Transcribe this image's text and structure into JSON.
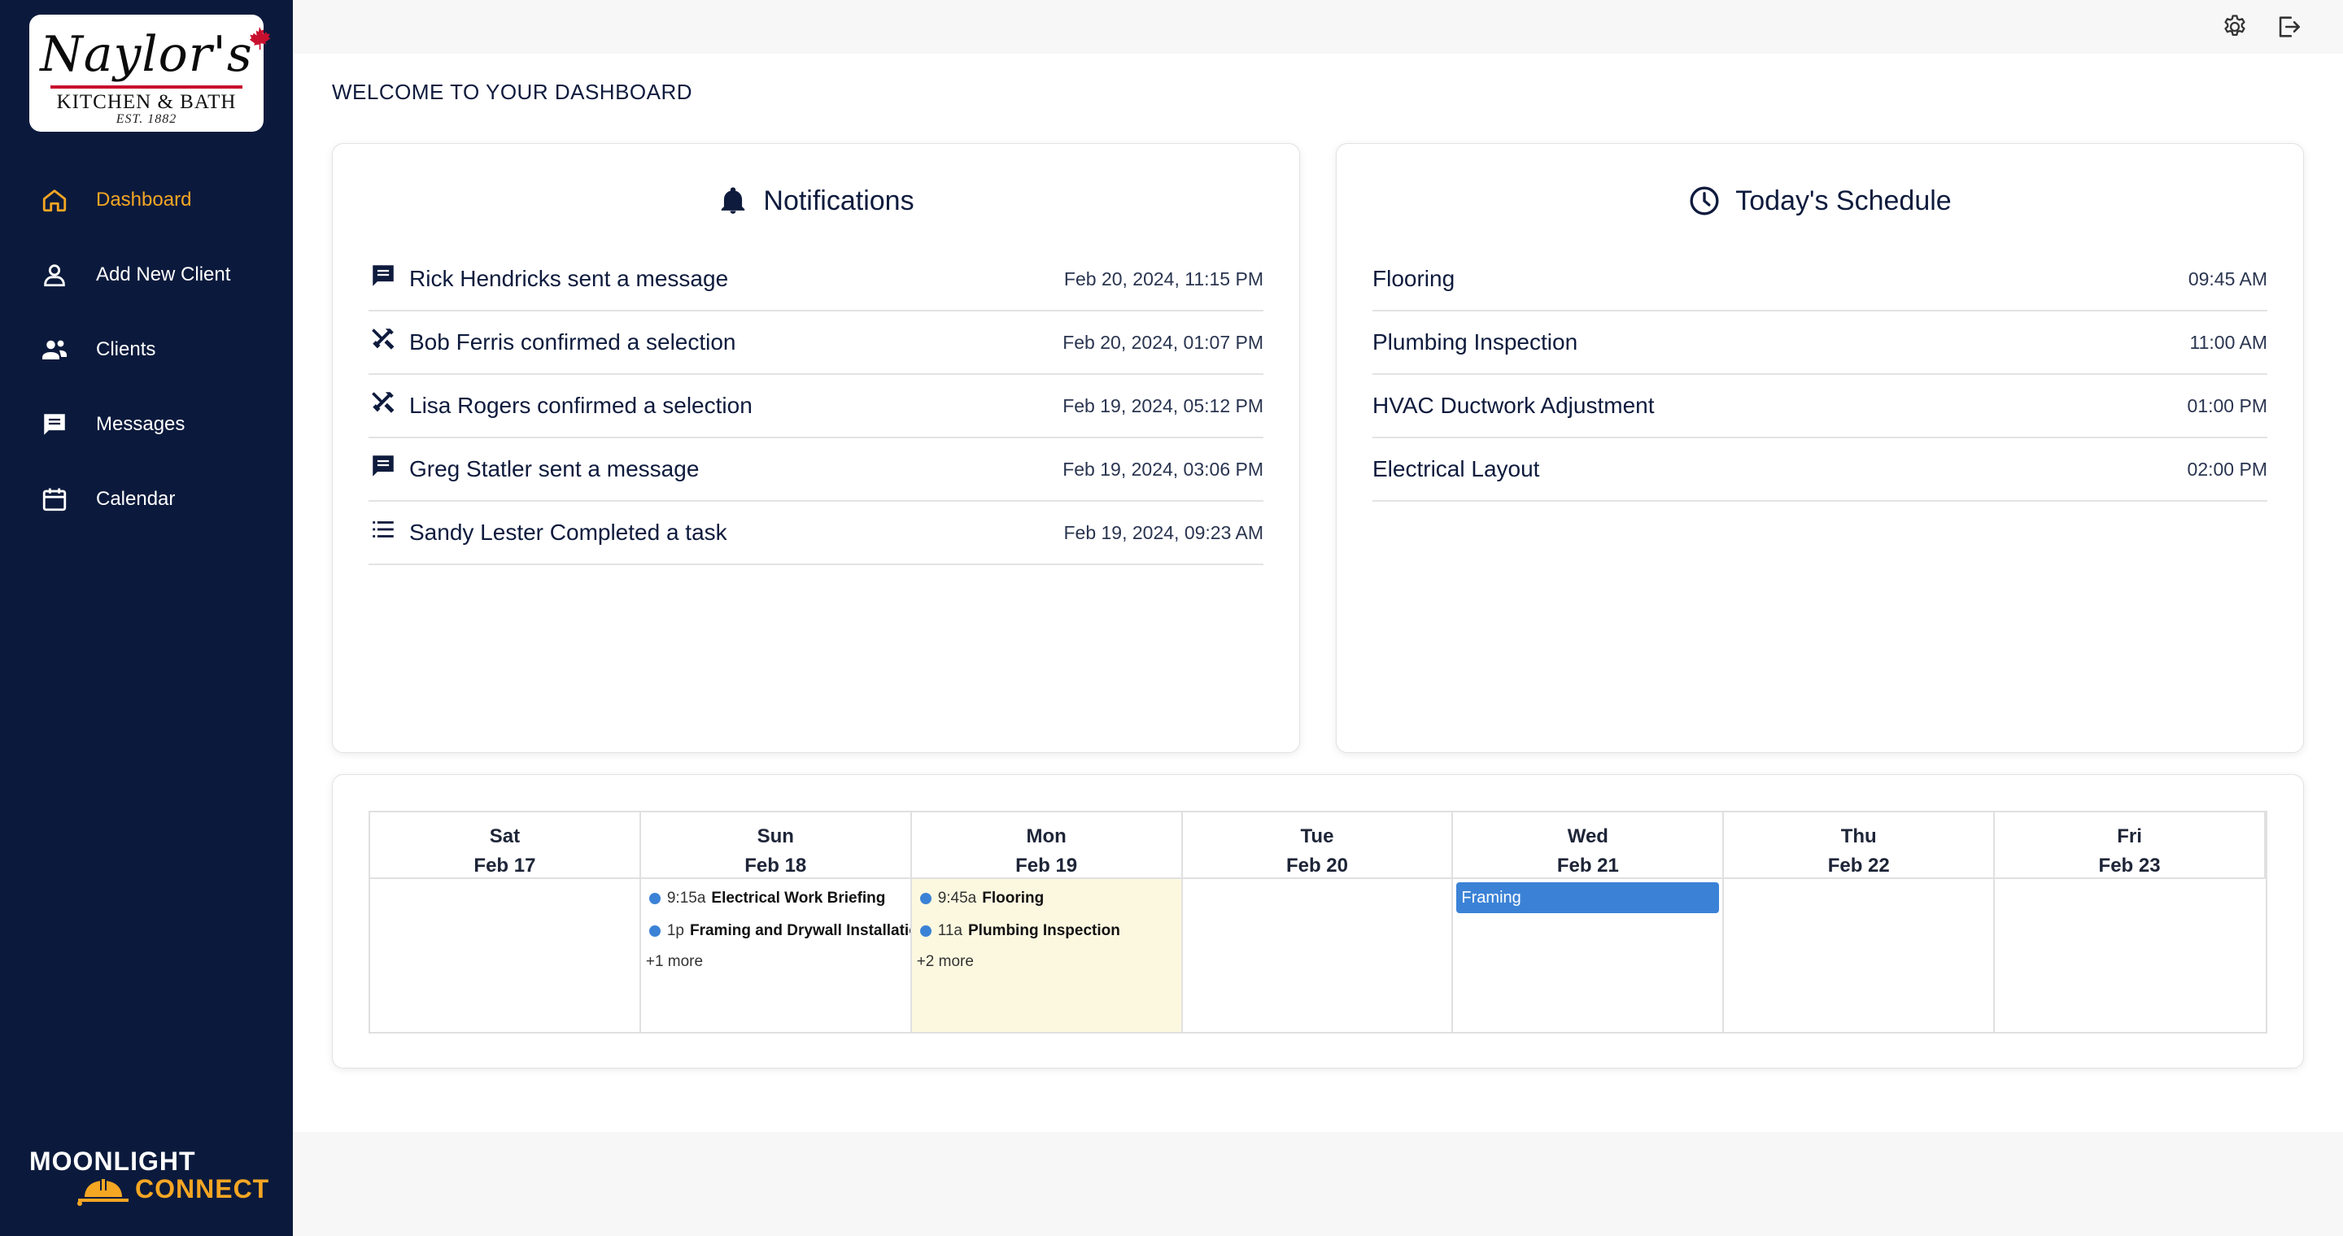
{
  "logo": {
    "name": "Naylor's",
    "subtitle": "KITCHEN & BATH",
    "established": "EST. 1882"
  },
  "sidebar": {
    "items": [
      {
        "label": "Dashboard",
        "icon": "home-icon",
        "active": true
      },
      {
        "label": "Add New Client",
        "icon": "person-icon",
        "active": false
      },
      {
        "label": "Clients",
        "icon": "people-icon",
        "active": false
      },
      {
        "label": "Messages",
        "icon": "message-icon",
        "active": false
      },
      {
        "label": "Calendar",
        "icon": "calendar-icon",
        "active": false
      }
    ]
  },
  "brand": {
    "top": "MOONLIGHT",
    "bottom": "CONNECT"
  },
  "topbar": {
    "icons": [
      "gear-icon",
      "logout-icon"
    ]
  },
  "page": {
    "welcome": "WELCOME TO YOUR DASHBOARD"
  },
  "notifications": {
    "title": "Notifications",
    "items": [
      {
        "icon": "message-icon",
        "text": "Rick Hendricks sent a message",
        "date": "Feb 20, 2024, 11:15 PM"
      },
      {
        "icon": "tools-icon",
        "text": "Bob Ferris confirmed a selection",
        "date": "Feb 20, 2024, 01:07 PM"
      },
      {
        "icon": "tools-icon",
        "text": "Lisa Rogers confirmed a selection",
        "date": "Feb 19, 2024, 05:12 PM"
      },
      {
        "icon": "message-icon",
        "text": "Greg Statler sent a message",
        "date": "Feb 19, 2024, 03:06 PM"
      },
      {
        "icon": "list-icon",
        "text": "Sandy Lester Completed a task",
        "date": "Feb 19, 2024, 09:23 AM"
      }
    ]
  },
  "schedule": {
    "title": "Today's Schedule",
    "items": [
      {
        "text": "Flooring",
        "time": "09:45 AM"
      },
      {
        "text": "Plumbing Inspection",
        "time": "11:00 AM"
      },
      {
        "text": "HVAC Ductwork Adjustment",
        "time": "01:00 PM"
      },
      {
        "text": "Electrical Layout",
        "time": "02:00 PM"
      }
    ]
  },
  "calendar": {
    "days": [
      {
        "dow": "Sat",
        "date": "Feb 17"
      },
      {
        "dow": "Sun",
        "date": "Feb 18"
      },
      {
        "dow": "Mon",
        "date": "Feb 19"
      },
      {
        "dow": "Tue",
        "date": "Feb 20"
      },
      {
        "dow": "Wed",
        "date": "Feb 21"
      },
      {
        "dow": "Thu",
        "date": "Feb 22"
      },
      {
        "dow": "Fri",
        "date": "Feb 23"
      }
    ],
    "sun": {
      "events": [
        {
          "time": "9:15a",
          "title": "Electrical Work Briefing"
        },
        {
          "time": "1p",
          "title": "Framing and Drywall Installation"
        }
      ],
      "more": "+1 more"
    },
    "mon": {
      "events": [
        {
          "time": "9:45a",
          "title": "Flooring"
        },
        {
          "time": "11a",
          "title": "Plumbing Inspection"
        }
      ],
      "more": "+2 more"
    },
    "wed": {
      "bar": "Framing"
    },
    "event_color": "#3b82d6",
    "today_highlight": "#fcf8e0"
  },
  "colors": {
    "sidebar": "#0b1a3c",
    "accent": "#f5a623",
    "text": "#0e1b3d"
  }
}
